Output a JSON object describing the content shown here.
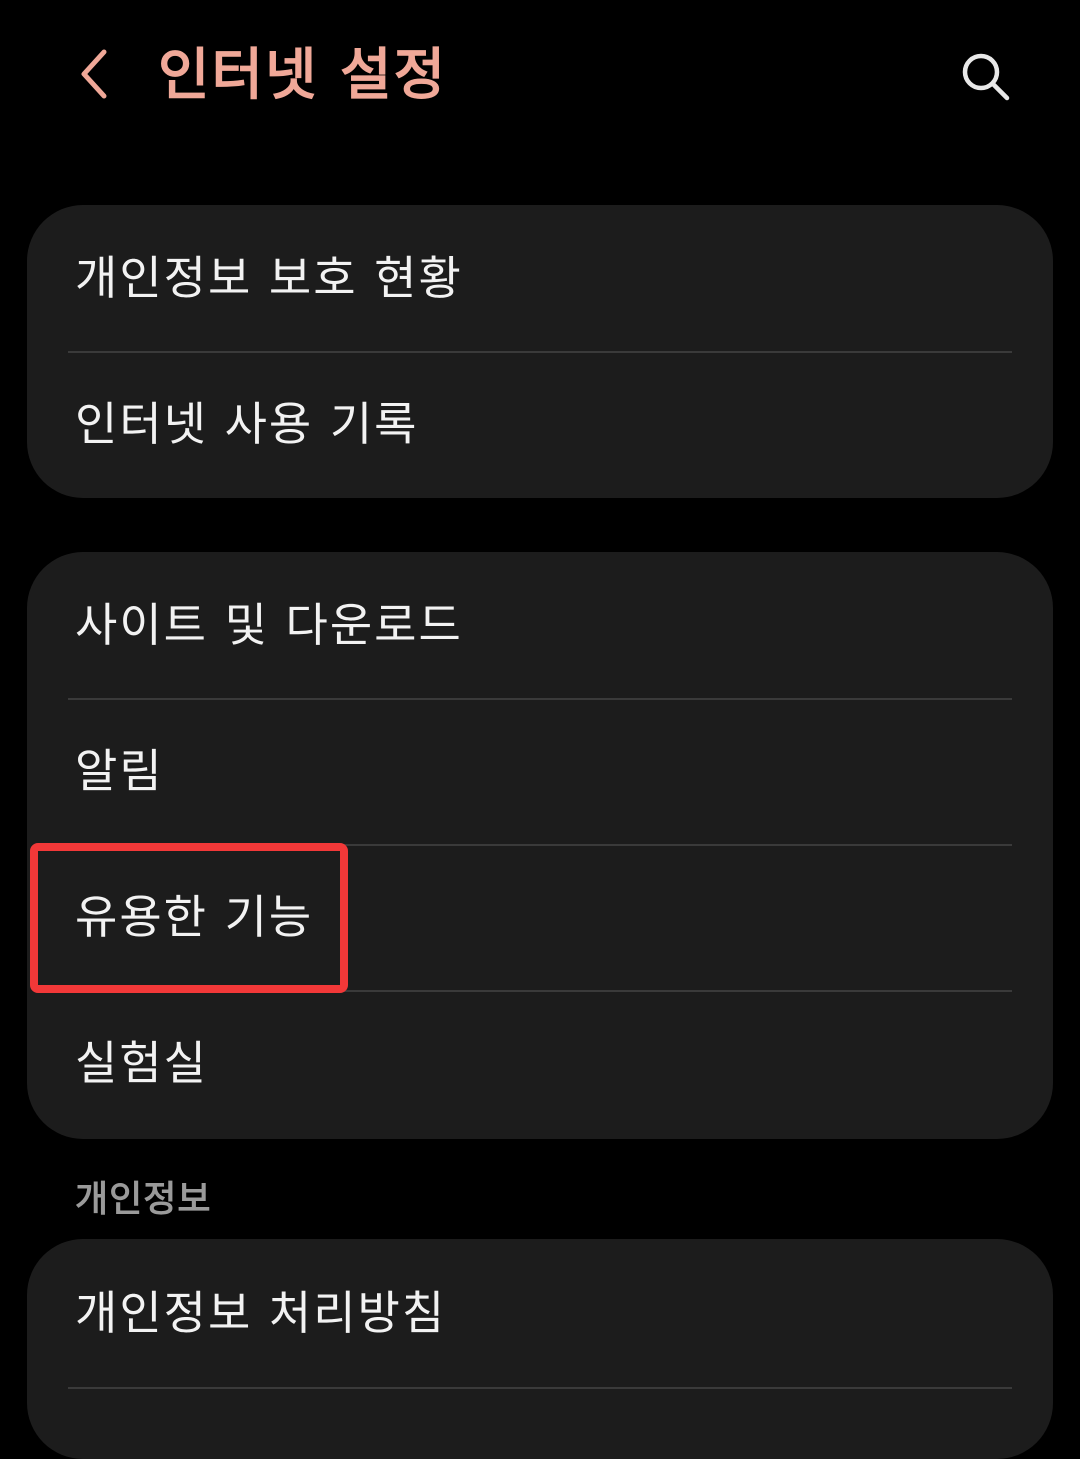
{
  "header": {
    "title": "인터넷 설정",
    "back_icon": "chevron-left-icon",
    "search_icon": "search-icon"
  },
  "colors": {
    "title": "#f0a898",
    "background": "#000000",
    "card": "#1c1c1c",
    "highlight": "#f23838",
    "section_label": "#9a9a9a"
  },
  "groups": [
    {
      "items": [
        {
          "label": "개인정보 보호 현황"
        },
        {
          "label": "인터넷 사용 기록"
        }
      ]
    },
    {
      "items": [
        {
          "label": "사이트 및 다운로드"
        },
        {
          "label": "알림"
        },
        {
          "label": "유용한 기능",
          "highlighted": true
        },
        {
          "label": "실험실"
        }
      ]
    },
    {
      "section_label": "개인정보",
      "items": [
        {
          "label": "개인정보 처리방침"
        }
      ]
    }
  ]
}
